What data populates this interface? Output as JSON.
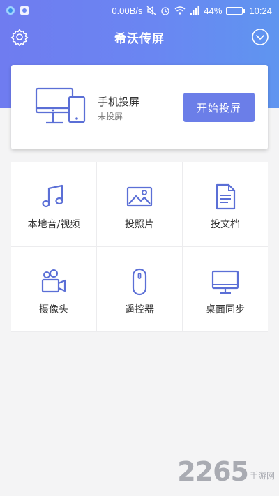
{
  "status_bar": {
    "speed": "0.00B/s",
    "battery": "44%",
    "battery_level": 0.44,
    "time": "10:24"
  },
  "header": {
    "title": "希沃传屏",
    "left_icon": "gear-icon",
    "right_icon": "chevron-down-circle-icon"
  },
  "cast_card": {
    "title": "手机投屏",
    "status": "未投屏",
    "button_label": "开始投屏",
    "icon": "monitor-phone-icon"
  },
  "grid": [
    {
      "label": "本地音/视频",
      "icon": "music-note-icon"
    },
    {
      "label": "投照片",
      "icon": "picture-icon"
    },
    {
      "label": "投文档",
      "icon": "document-icon"
    },
    {
      "label": "摄像头",
      "icon": "camera-icon"
    },
    {
      "label": "遥控器",
      "icon": "mouse-icon"
    },
    {
      "label": "桌面同步",
      "icon": "desktop-icon"
    }
  ],
  "watermark": {
    "number": "2265",
    "text": "手游网"
  },
  "colors": {
    "accent": "#6b7ee8",
    "header_gradient_start": "#6f7cf0",
    "header_gradient_end": "#5f95f0",
    "icon": "#5b6fd6"
  }
}
